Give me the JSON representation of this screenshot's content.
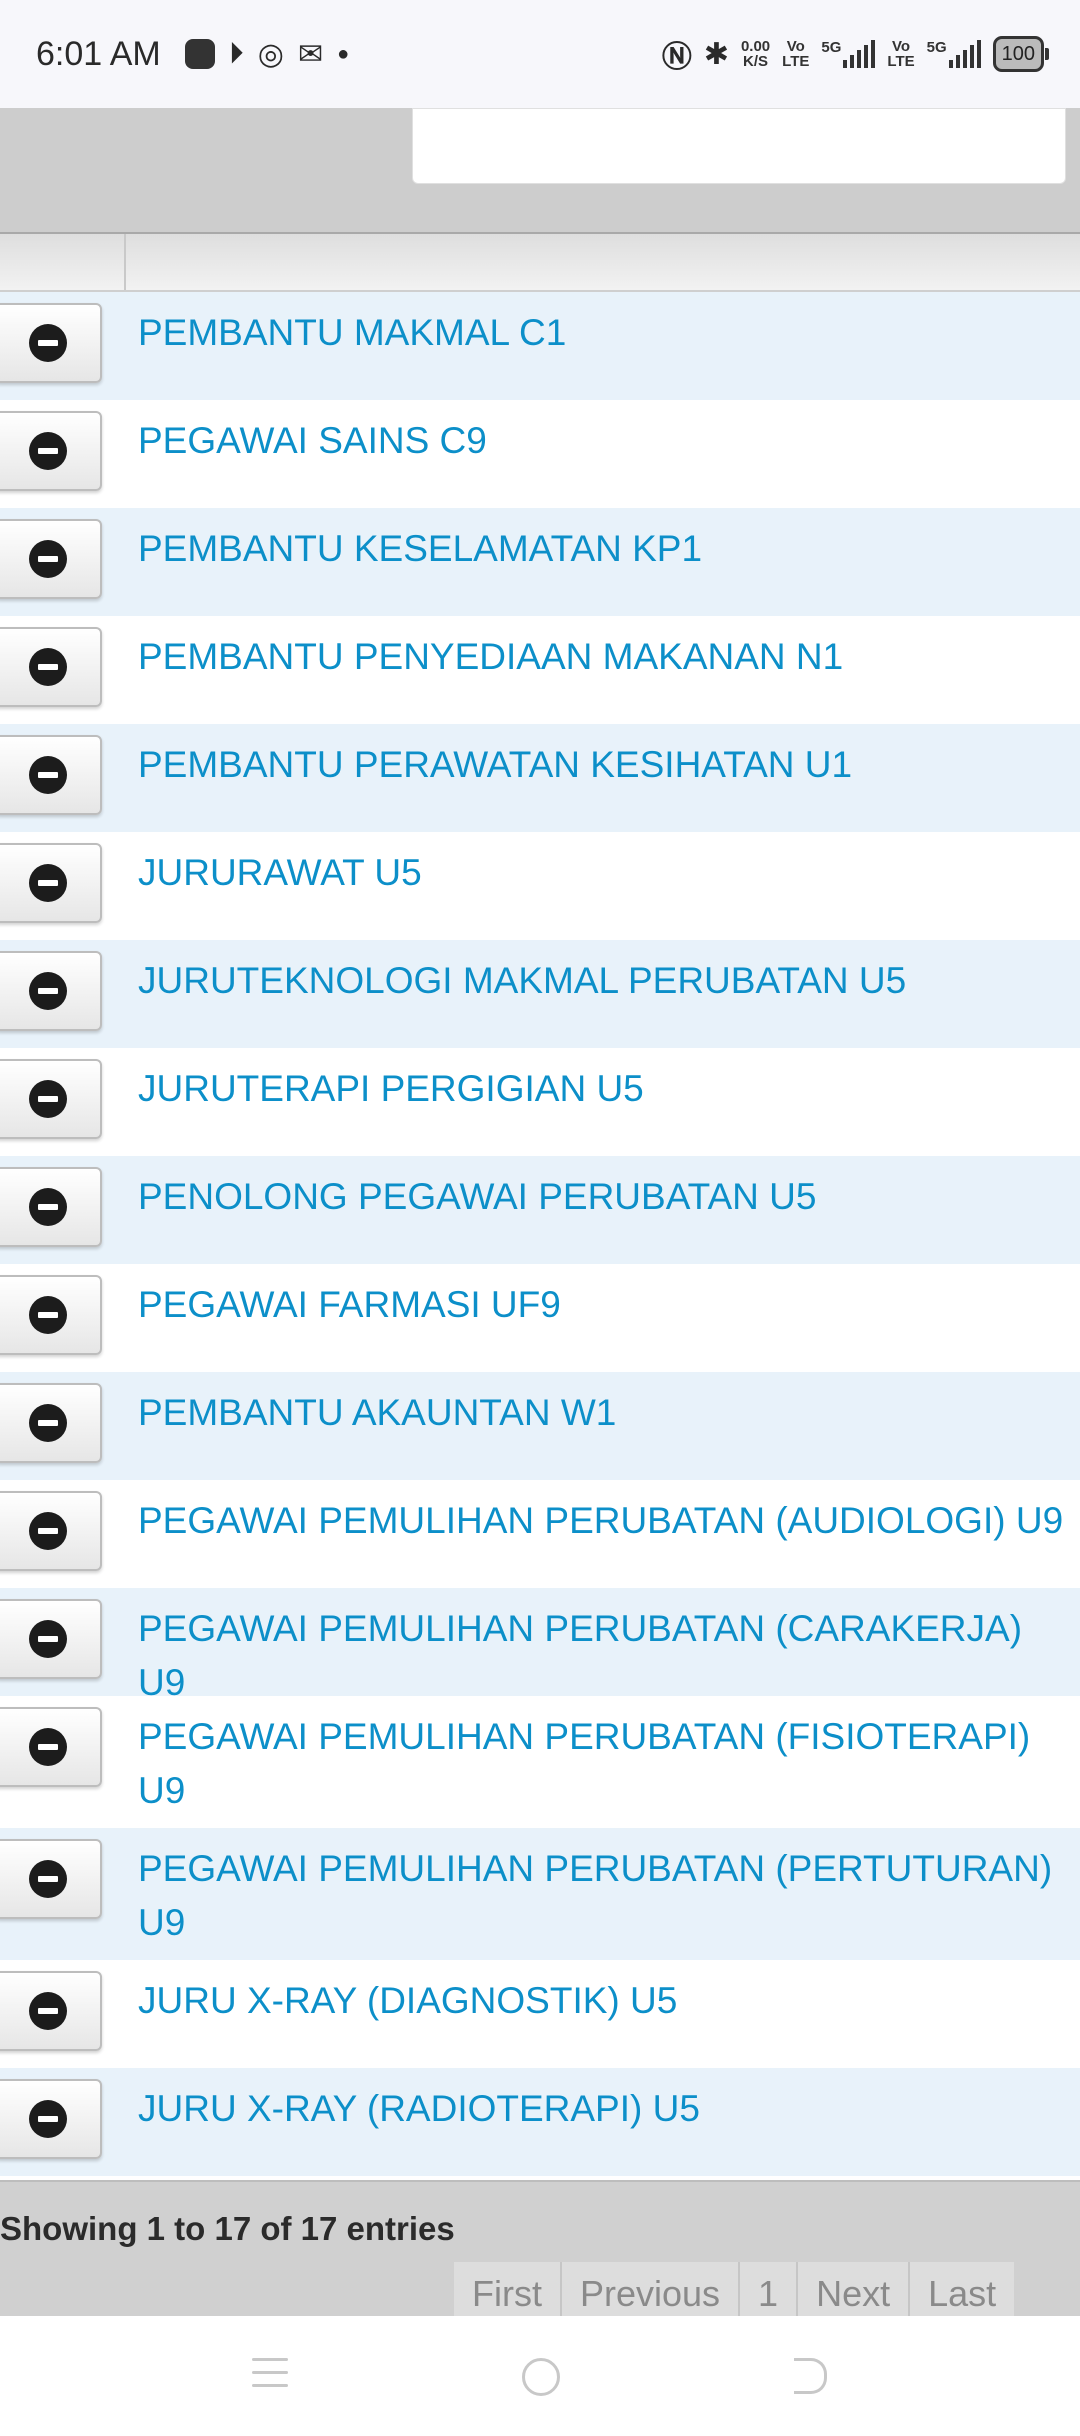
{
  "status_bar": {
    "time": "6:01 AM",
    "net_speed_value": "0.00",
    "net_speed_unit": "K/S",
    "sim1_top": "Vo",
    "sim1_bottom": "LTE",
    "sim1_signal": "5G",
    "sim2_top": "Vo",
    "sim2_bottom": "LTE",
    "sim2_signal": "5G",
    "battery": "100",
    "icons": [
      "app-icon",
      "youtube-icon",
      "instagram-icon",
      "email-icon",
      "dot-icon",
      "nfc-icon",
      "bluetooth-icon"
    ]
  },
  "search": {
    "value": ""
  },
  "rows": [
    "PEMBANTU MAKMAL C1",
    "PEGAWAI SAINS C9",
    "PEMBANTU KESELAMATAN KP1",
    "PEMBANTU PENYEDIAAN MAKANAN N1",
    "PEMBANTU PERAWATAN KESIHATAN U1",
    "JURURAWAT U5",
    "JURUTEKNOLOGI MAKMAL PERUBATAN U5",
    "JURUTERAPI PERGIGIAN U5",
    "PENOLONG PEGAWAI PERUBATAN U5",
    "PEGAWAI FARMASI UF9",
    "PEMBANTU AKAUNTAN W1",
    "PEGAWAI PEMULIHAN PERUBATAN (AUDIOLOGI) U9",
    "PEGAWAI PEMULIHAN PERUBATAN (CARAKERJA) U9",
    "PEGAWAI PEMULIHAN PERUBATAN (FISIOTERAPI) U9",
    "PEGAWAI PEMULIHAN PERUBATAN (PERTUTURAN) U9",
    "JURU X-RAY (DIAGNOSTIK) U5",
    "JURU X-RAY (RADIOTERAPI) U5"
  ],
  "footer": {
    "info": "Showing 1 to 17 of 17 entries",
    "pagination": {
      "first": "First",
      "previous": "Previous",
      "page": "1",
      "next": "Next",
      "last": "Last"
    }
  },
  "colors": {
    "link": "#0c8fc9",
    "row_stripe": "#e8f2fa",
    "panel": "#cdcdcd"
  }
}
